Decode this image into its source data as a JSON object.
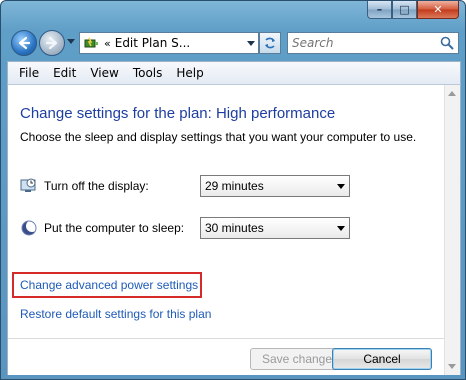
{
  "window": {
    "controls": {
      "minimize": "–",
      "maximize": "□",
      "close": "✕"
    }
  },
  "navbar": {
    "address_separator": "«",
    "address_text": "Edit Plan S...",
    "search_placeholder": "Search",
    "icons": {
      "back": "back-arrow-icon",
      "forward": "forward-arrow-icon",
      "address": "power-options-icon",
      "refresh": "refresh-icon",
      "search": "search-icon"
    }
  },
  "menu": [
    "File",
    "Edit",
    "View",
    "Tools",
    "Help"
  ],
  "page": {
    "title": "Change settings for the plan: High performance",
    "subtitle": "Choose the sleep and display settings that you want your computer to use.",
    "settings": [
      {
        "label": "Turn off the display:",
        "value": "29 minutes",
        "icon": "display-clock-icon"
      },
      {
        "label": "Put the computer to sleep:",
        "value": "30 minutes",
        "icon": "moon-sleep-icon"
      }
    ],
    "links": {
      "advanced": "Change advanced power settings",
      "restore": "Restore default settings for this plan"
    },
    "buttons": {
      "save": "Save changes",
      "cancel": "Cancel"
    }
  },
  "colors": {
    "title": "#1e3ea0",
    "link": "#1e5bb8",
    "highlight": "#d42a2a"
  }
}
